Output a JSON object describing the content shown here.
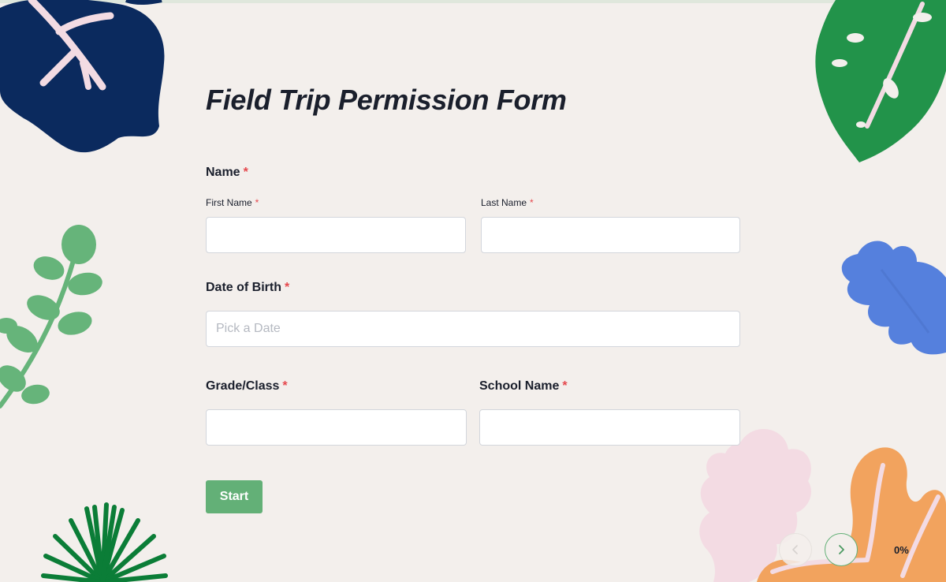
{
  "form": {
    "title": "Field Trip Permission Form",
    "required_mark": "*",
    "name_section": {
      "label": "Name",
      "first_name": {
        "label": "First Name",
        "value": "",
        "placeholder": ""
      },
      "last_name": {
        "label": "Last Name",
        "value": "",
        "placeholder": ""
      }
    },
    "date_of_birth": {
      "label": "Date of Birth",
      "value": "",
      "placeholder": "Pick a Date"
    },
    "grade_class": {
      "label": "Grade/Class",
      "value": "",
      "placeholder": ""
    },
    "school_name": {
      "label": "School Name",
      "value": "",
      "placeholder": ""
    },
    "start_label": "Start"
  },
  "navigation": {
    "prev_icon": "chevron-left-icon",
    "next_icon": "chevron-right-icon",
    "progress_percent": 0,
    "progress_text": "0%"
  },
  "colors": {
    "background": "#f3efec",
    "accent_green": "#63b077",
    "required_red": "#e5484d",
    "text": "#1a1f2c",
    "leaf_navy": "#0b2a5e",
    "leaf_green": "#22934a",
    "leaf_light_green": "#66b47a",
    "leaf_blue": "#5580dd",
    "leaf_pink": "#f3dbe3",
    "leaf_orange": "#f2a35e"
  }
}
